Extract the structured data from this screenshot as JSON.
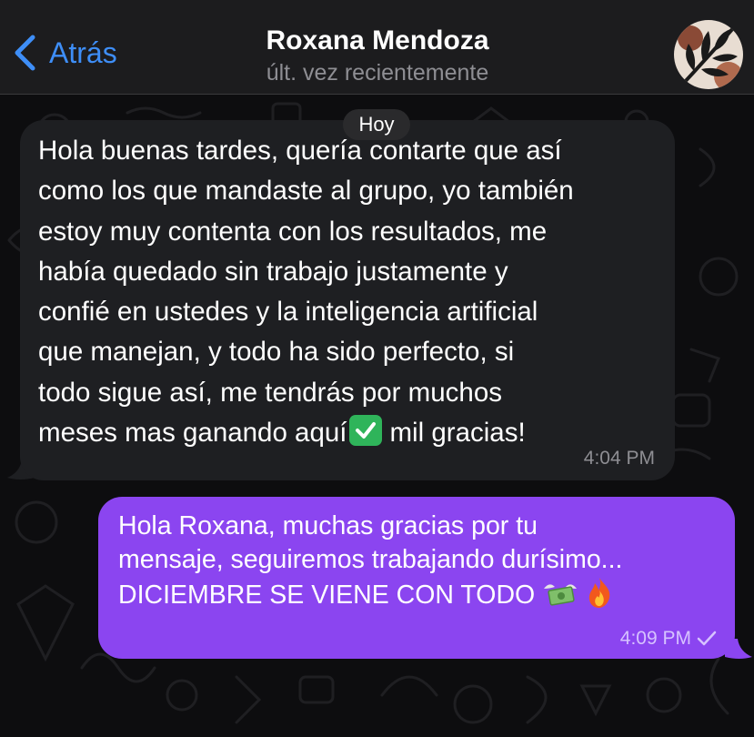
{
  "header": {
    "back_label": "Atrás",
    "contact_name": "Roxana Mendoza",
    "status": "últ. vez recientemente"
  },
  "date_divider": "Hoy",
  "messages": [
    {
      "direction": "incoming",
      "text": "Hola buenas tardes, quería contarte que así\ncomo los que mandaste al grupo, yo también\nestoy muy contenta con los resultados, me\nhabía quedado sin trabajo justamente y\nconfié en ustedes y la inteligencia artificial\nque manejan, y todo ha sido perfecto, si\ntodo sigue así, me tendrás por muchos\nmeses mas ganando aquí",
      "emoji": "check-mark-button-emoji",
      "text_after_emoji": "mil gracias!",
      "time": "4:04 PM"
    },
    {
      "direction": "outgoing",
      "text": "Hola Roxana, muchas gracias por tu\nmensaje, seguiremos trabajando durísimo...\nDICIEMBRE SE VIENE CON TODO",
      "emojis": [
        "money-with-wings-emoji",
        "fire-emoji"
      ],
      "time": "4:09 PM",
      "status": "sent-check"
    }
  ],
  "colors": {
    "header_bg": "#1c1c1e",
    "accent_blue": "#3e8ef7",
    "incoming_bubble": "#1e1f22",
    "outgoing_bubble": "#8b45f0",
    "chat_bg": "#0d0d0f"
  }
}
